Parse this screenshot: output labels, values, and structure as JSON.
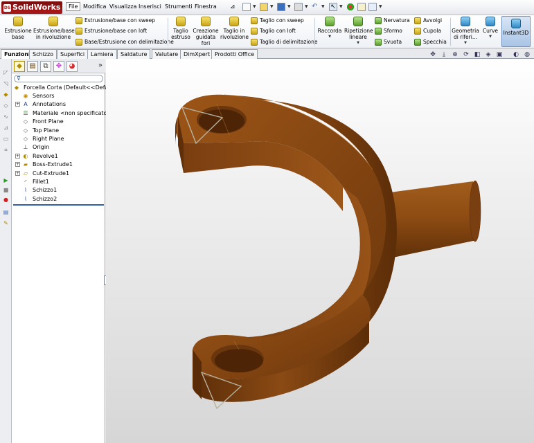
{
  "app": {
    "brand": "SolidWorks",
    "brand_badge": "DS"
  },
  "menu": {
    "file": "File",
    "modifica": "Modifica",
    "visualizza": "Visualizza",
    "inserisci": "Inserisci",
    "strumenti": "Strumenti",
    "finestra": "Finestra"
  },
  "ribbon": {
    "estrusione_base": [
      "Estrusione",
      "base"
    ],
    "estrusione_rivoluzione": [
      "Estrusione/base",
      "in rivoluzione"
    ],
    "estrusione_sweep": "Estrusione/base con sweep",
    "estrusione_loft": "Estrusione/base con loft",
    "base_delimitazione": "Base/Estrusione con delimitazione",
    "taglio_estruso": [
      "Taglio",
      "estruso"
    ],
    "creazione_fori": [
      "Creazione",
      "guidata",
      "fori"
    ],
    "taglio_rivoluzione": [
      "Taglio in",
      "rivoluzione"
    ],
    "taglio_sweep": "Taglio con sweep",
    "taglio_loft": "Taglio con loft",
    "taglio_delimitazione": "Taglio di delimitazione",
    "raccorda": "Raccorda",
    "ripetizione_lineare": [
      "Ripetizione",
      "lineare"
    ],
    "nervatura": "Nervatura",
    "sformo": "Sformo",
    "svuota": "Svuota",
    "avvolgi": "Avvolgi",
    "cupola": "Cupola",
    "specchia": "Specchia",
    "geometria_riferimento": [
      "Geometria",
      "di riferi..."
    ],
    "curve": "Curve",
    "instant3d": "Instant3D"
  },
  "tabs": [
    "Funzioni",
    "Schizzo",
    "Superfici",
    "Lamiera",
    "Saldature",
    "Valutare",
    "DimXpert",
    "Prodotti Office"
  ],
  "tree": {
    "root": "Forcella Corta  (Default<<Default",
    "items": [
      {
        "label": "Sensors",
        "icon": "sensors-icon",
        "expandable": false
      },
      {
        "label": "Annotations",
        "icon": "annotations-icon",
        "expandable": true
      },
      {
        "label": "Materiale <non specificato>",
        "icon": "material-icon",
        "expandable": false
      },
      {
        "label": "Front Plane",
        "icon": "plane-icon",
        "expandable": false
      },
      {
        "label": "Top Plane",
        "icon": "plane-icon",
        "expandable": false
      },
      {
        "label": "Right Plane",
        "icon": "plane-icon",
        "expandable": false
      },
      {
        "label": "Origin",
        "icon": "origin-icon",
        "expandable": false
      },
      {
        "label": "Revolve1",
        "icon": "revolve-icon",
        "expandable": true
      },
      {
        "label": "Boss-Extrude1",
        "icon": "extrude-icon",
        "expandable": true
      },
      {
        "label": "Cut-Extrude1",
        "icon": "cut-extrude-icon",
        "expandable": true
      },
      {
        "label": "Fillet1",
        "icon": "fillet-icon",
        "expandable": false
      },
      {
        "label": "Schizzo1",
        "icon": "sketch-icon",
        "expandable": false
      },
      {
        "label": "Schizzo2",
        "icon": "sketch-icon",
        "expandable": false
      }
    ]
  },
  "colors": {
    "model_face": "#8c4a14",
    "model_top": "#7a3e10",
    "model_side": "#5e2f0a",
    "accent": "#2f5fad"
  }
}
